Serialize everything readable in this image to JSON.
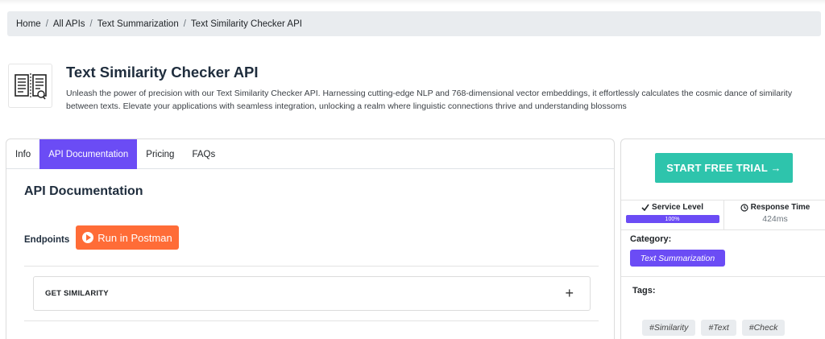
{
  "breadcrumb": {
    "items": [
      "Home",
      "All APIs",
      "Text Summarization",
      "Text Similarity Checker API"
    ],
    "separator": "/"
  },
  "api": {
    "logo_icon": "document-compare-icon",
    "title": "Text Similarity Checker API",
    "description": "Unleash the power of precision with our Text Similarity Checker API. Harnessing cutting-edge NLP and 768-dimensional vector embeddings, it effortlessly calculates the cosmic dance of similarity between texts. Elevate your applications with seamless integration, unlocking a realm where linguistic connections thrive and understanding blossoms"
  },
  "tabs": [
    {
      "label": "Info",
      "active": false
    },
    {
      "label": "API Documentation",
      "active": true
    },
    {
      "label": "Pricing",
      "active": false
    },
    {
      "label": "FAQs",
      "active": false
    }
  ],
  "docs": {
    "title": "API Documentation",
    "endpoints_label": "Endpoints",
    "postman_label": "Run in Postman",
    "endpoint_name": "GET SIMILARITY",
    "expand_symbol": "+"
  },
  "sidebar": {
    "trial_button": "START FREE TRIAL →",
    "service_level": {
      "label": "Service Level",
      "value": "100%",
      "fraction": 1.0
    },
    "response_time": {
      "label": "Response Time",
      "value": "424ms"
    },
    "category_label": "Category:",
    "category": "Text Summarization",
    "tags_label": "Tags:",
    "tags": [
      "#Similarity",
      "#Text",
      "#Check"
    ]
  },
  "colors": {
    "accent": "#6b4cf5",
    "trial": "#2ec4ac",
    "postman": "#ff6c37"
  }
}
